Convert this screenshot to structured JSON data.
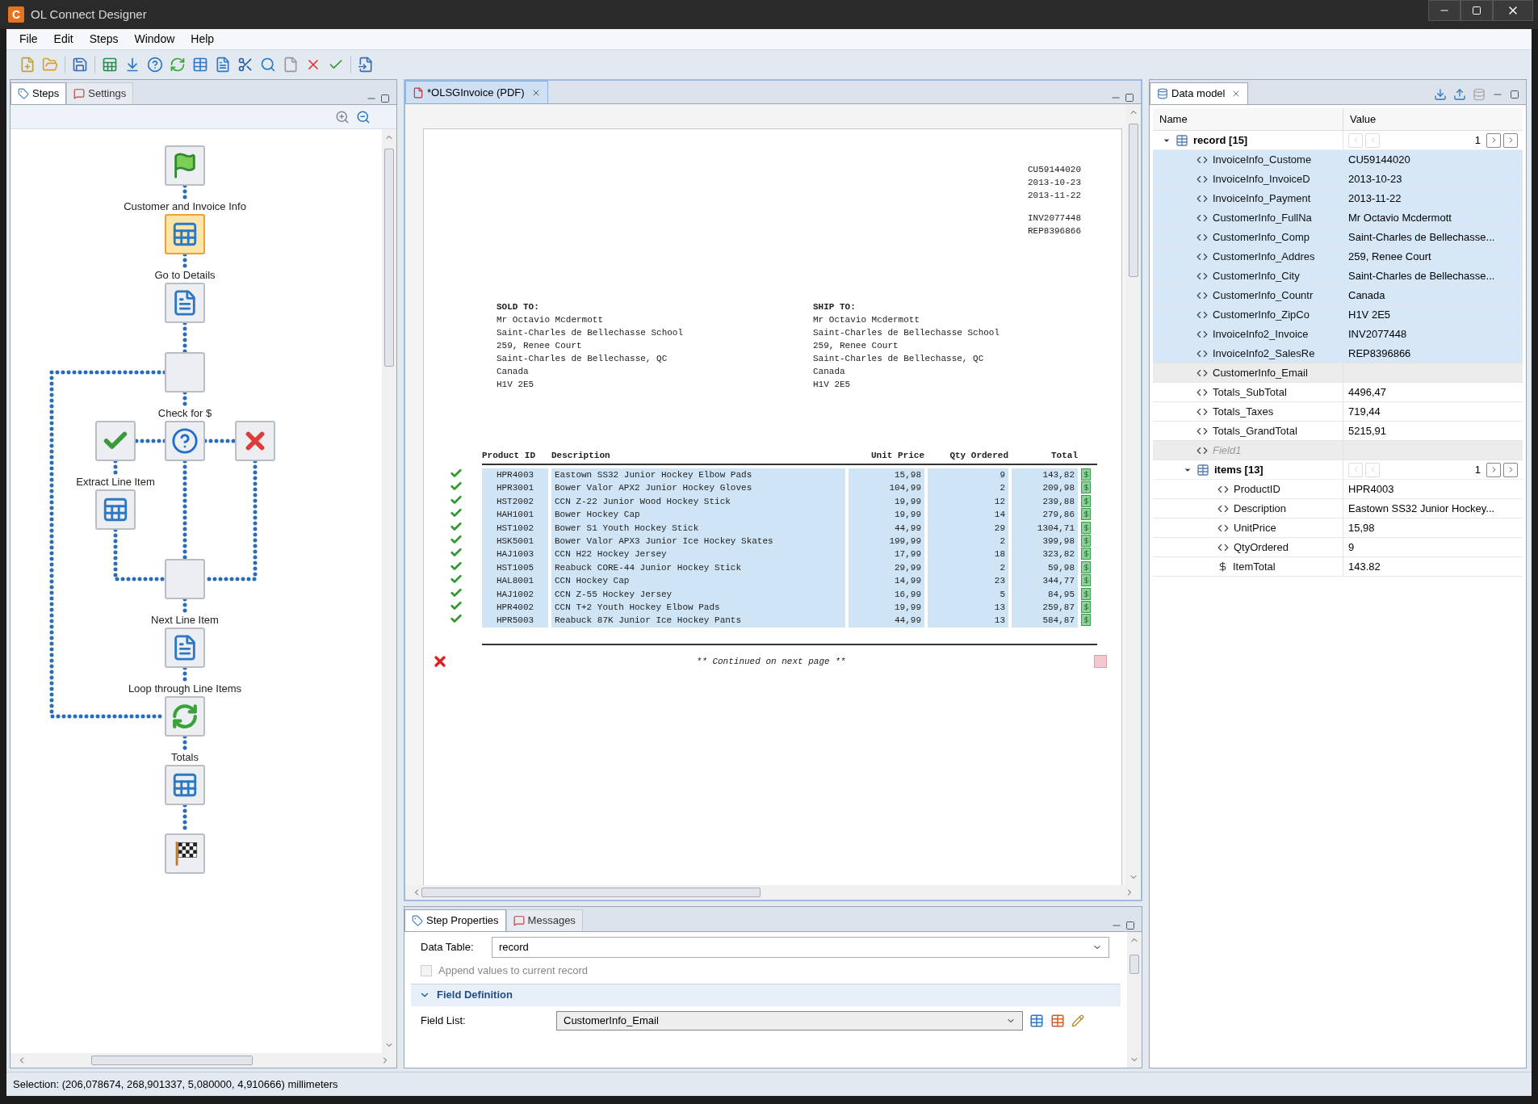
{
  "window": {
    "app_icon_letter": "C",
    "title": "OL Connect Designer"
  },
  "menu": [
    "File",
    "Edit",
    "Steps",
    "Window",
    "Help"
  ],
  "steps_panel": {
    "tabs": [
      {
        "label": "Steps",
        "selected": true
      },
      {
        "label": "Settings",
        "selected": false
      }
    ],
    "nodes": [
      {
        "kind": "start",
        "selected": false
      },
      {
        "kind": "extract",
        "label": "Customer and Invoice Info",
        "selected": true
      },
      {
        "kind": "goto",
        "label": "Go to Details",
        "selected": false
      },
      {
        "kind": "loop_start",
        "selected": false
      },
      {
        "kind": "condition",
        "label": "Check for $",
        "selected": false
      },
      {
        "kind": "action_true",
        "selected": false
      },
      {
        "kind": "action_false",
        "selected": false
      },
      {
        "kind": "extract",
        "label": "Extract Line Item",
        "selected": false
      },
      {
        "kind": "join",
        "selected": false
      },
      {
        "kind": "goto",
        "label": "Next Line Item",
        "selected": false
      },
      {
        "kind": "loop",
        "label": "Loop through Line Items",
        "selected": false
      },
      {
        "kind": "extract",
        "label": "Totals",
        "selected": false
      },
      {
        "kind": "end",
        "selected": false
      }
    ]
  },
  "editor": {
    "tab": {
      "label": "*OLSGInvoice (PDF)"
    },
    "page": {
      "header_groups": [
        [
          "CU59144020",
          "2013-10-23",
          "2013-11-22"
        ],
        [
          "INV2077448",
          "REP8396866"
        ]
      ],
      "sold_to": {
        "heading": "SOLD TO:",
        "lines": [
          "Mr Octavio Mcdermott",
          "Saint-Charles de Bellechasse School",
          "259, Renee Court",
          "Saint-Charles de Bellechasse, QC",
          "Canada",
          "H1V 2E5"
        ]
      },
      "ship_to": {
        "heading": "SHIP TO:",
        "lines": [
          "Mr Octavio Mcdermott",
          "Saint-Charles de Bellechasse School",
          "259, Renee Court",
          "Saint-Charles de Bellechasse, QC",
          "Canada",
          "H1V 2E5"
        ]
      },
      "table": {
        "columns": [
          "Product ID",
          "Description",
          "Unit Price",
          "Qty Ordered",
          "Total"
        ],
        "rows": [
          {
            "valid": true,
            "cells": [
              "HPR4003",
              "Eastown SS32 Junior Hockey Elbow Pads",
              "15,98",
              "9",
              "143,82"
            ]
          },
          {
            "valid": true,
            "cells": [
              "HPR3001",
              "Bower Valor APX2 Junior Hockey Gloves",
              "104,99",
              "2",
              "209,98"
            ]
          },
          {
            "valid": true,
            "cells": [
              "HST2002",
              "CCN Z-22 Junior Wood Hockey Stick",
              "19,99",
              "12",
              "239,88"
            ]
          },
          {
            "valid": true,
            "cells": [
              "HAH1001",
              "Bower Hockey Cap",
              "19,99",
              "14",
              "279,86"
            ]
          },
          {
            "valid": true,
            "cells": [
              "HST1002",
              "Bower S1 Youth Hockey Stick",
              "44,99",
              "29",
              "1304,71"
            ]
          },
          {
            "valid": true,
            "cells": [
              "HSK5001",
              "Bower Valor APX3 Junior Ice Hockey Skates",
              "199,99",
              "2",
              "399,98"
            ]
          },
          {
            "valid": true,
            "cells": [
              "HAJ1003",
              "CCN H22 Hockey Jersey",
              "17,99",
              "18",
              "323,82"
            ]
          },
          {
            "valid": true,
            "cells": [
              "HST1005",
              "Reabuck CORE-44 Junior Hockey Stick",
              "29,99",
              "2",
              "59,98"
            ]
          },
          {
            "valid": true,
            "cells": [
              "HAL8001",
              "CCN Hockey Cap",
              "14,99",
              "23",
              "344,77"
            ]
          },
          {
            "valid": true,
            "cells": [
              "HAJ1002",
              "CCN Z-55 Hockey Jersey",
              "16,99",
              "5",
              "84,95"
            ]
          },
          {
            "valid": true,
            "cells": [
              "HPR4002",
              "CCN T+2 Youth Hockey Elbow Pads",
              "19,99",
              "13",
              "259,87"
            ]
          },
          {
            "valid": true,
            "cells": [
              "HPR5003",
              "Reabuck 87K Junior Ice Hockey Pants",
              "44,99",
              "13",
              "584,87"
            ]
          }
        ]
      },
      "footer": {
        "text": "** Continued on next page **",
        "valid": false
      }
    }
  },
  "properties": {
    "tabs": [
      {
        "label": "Step Properties",
        "selected": true
      },
      {
        "label": "Messages",
        "selected": false
      }
    ],
    "data_table": {
      "label": "Data Table:",
      "value": "record"
    },
    "append": {
      "label": "Append values to current record",
      "checked": false,
      "disabled": true
    },
    "section": {
      "title": "Field Definition",
      "expanded": true
    },
    "field_list": {
      "label": "Field List:",
      "value": "CustomerInfo_Email"
    }
  },
  "data_model": {
    "tab": {
      "label": "Data model"
    },
    "columns": [
      "Name",
      "Value"
    ],
    "tree": [
      {
        "kind": "table",
        "name": "record [15]",
        "index": "1",
        "expanded": true,
        "children": [
          {
            "kind": "field",
            "name": "InvoiceInfo_Custome",
            "value": "CU59144020",
            "selected": true,
            "highlighted": false,
            "disabled": false
          },
          {
            "kind": "field",
            "name": "InvoiceInfo_InvoiceD",
            "value": "2013-10-23",
            "selected": true,
            "highlighted": false,
            "disabled": false
          },
          {
            "kind": "field",
            "name": "InvoiceInfo_Payment",
            "value": "2013-11-22",
            "selected": true,
            "highlighted": false,
            "disabled": false
          },
          {
            "kind": "field",
            "name": "CustomerInfo_FullNa",
            "value": "Mr Octavio Mcdermott",
            "selected": true,
            "highlighted": false,
            "disabled": false
          },
          {
            "kind": "field",
            "name": "CustomerInfo_Comp",
            "value": "Saint-Charles de Bellechasse...",
            "selected": true,
            "highlighted": false,
            "disabled": false
          },
          {
            "kind": "field",
            "name": "CustomerInfo_Addres",
            "value": "259, Renee Court",
            "selected": true,
            "highlighted": false,
            "disabled": false
          },
          {
            "kind": "field",
            "name": "CustomerInfo_City",
            "value": "Saint-Charles de Bellechasse...",
            "selected": true,
            "highlighted": false,
            "disabled": false
          },
          {
            "kind": "field",
            "name": "CustomerInfo_Countr",
            "value": "Canada",
            "selected": true,
            "highlighted": false,
            "disabled": false
          },
          {
            "kind": "field",
            "name": "CustomerInfo_ZipCo",
            "value": "H1V 2E5",
            "selected": true,
            "highlighted": false,
            "disabled": false
          },
          {
            "kind": "field",
            "name": "InvoiceInfo2_Invoice",
            "value": "INV2077448",
            "selected": true,
            "highlighted": false,
            "disabled": false
          },
          {
            "kind": "field",
            "name": "InvoiceInfo2_SalesRe",
            "value": "REP8396866",
            "selected": true,
            "highlighted": false,
            "disabled": false
          },
          {
            "kind": "field",
            "name": "CustomerInfo_Email",
            "selected": false,
            "highlighted": true,
            "disabled": false
          },
          {
            "kind": "field",
            "name": "Totals_SubTotal",
            "value": "4496,47",
            "selected": false,
            "highlighted": false,
            "disabled": false
          },
          {
            "kind": "field",
            "name": "Totals_Taxes",
            "value": "719,44",
            "selected": false,
            "highlighted": false,
            "disabled": false
          },
          {
            "kind": "field",
            "name": "Totals_GrandTotal",
            "value": "5215,91",
            "selected": false,
            "highlighted": false,
            "disabled": false
          },
          {
            "kind": "field",
            "name": "Field1",
            "selected": false,
            "highlighted": true,
            "disabled": true
          },
          {
            "kind": "table",
            "name": "items [13]",
            "index": "1",
            "expanded": true,
            "children": [
              {
                "kind": "field",
                "name": "ProductID",
                "value": "HPR4003",
                "selected": false,
                "highlighted": false,
                "disabled": false
              },
              {
                "kind": "field",
                "name": "Description",
                "value": "Eastown SS32 Junior Hockey...",
                "selected": false,
                "highlighted": false,
                "disabled": false
              },
              {
                "kind": "field",
                "name": "UnitPrice",
                "value": "15,98",
                "selected": false,
                "highlighted": false,
                "disabled": false
              },
              {
                "kind": "field",
                "name": "QtyOrdered",
                "value": "9",
                "selected": false,
                "highlighted": false,
                "disabled": false
              },
              {
                "kind": "expression",
                "name": "ItemTotal",
                "value": "143.82",
                "selected": false,
                "highlighted": false,
                "disabled": false
              }
            ]
          }
        ]
      }
    ]
  },
  "status_bar": {
    "text": "Selection: (206,078674, 268,901337, 5,080000, 4,910666) millimeters"
  }
}
